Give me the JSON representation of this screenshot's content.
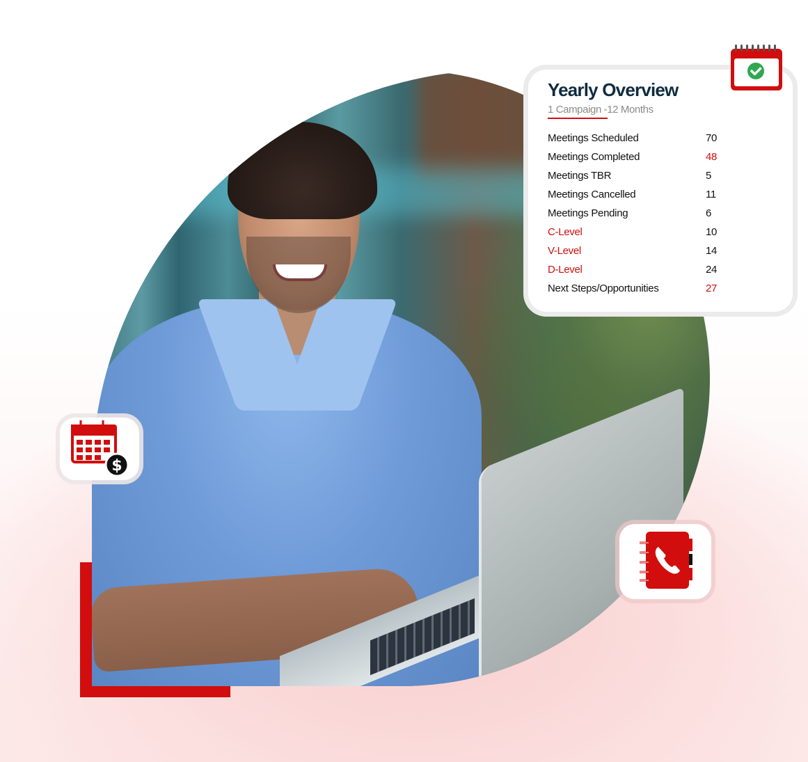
{
  "overview_card": {
    "title": "Yearly Overview",
    "subtitle": "1 Campaign -12 Months",
    "stats": [
      {
        "label": "Meetings Scheduled",
        "value": "70",
        "label_color": "default",
        "value_color": "default"
      },
      {
        "label": "Meetings Completed",
        "value": "48",
        "label_color": "default",
        "value_color": "red"
      },
      {
        "label": "Meetings TBR",
        "value": "5",
        "label_color": "default",
        "value_color": "default"
      },
      {
        "label": "Meetings Cancelled",
        "value": "11",
        "label_color": "default",
        "value_color": "default"
      },
      {
        "label": "Meetings Pending",
        "value": "6",
        "label_color": "default",
        "value_color": "default"
      },
      {
        "label": "C-Level",
        "value": "10",
        "label_color": "red",
        "value_color": "default"
      },
      {
        "label": "V-Level",
        "value": "14",
        "label_color": "red",
        "value_color": "default"
      },
      {
        "label": "D-Level",
        "value": "24",
        "label_color": "red",
        "value_color": "default"
      },
      {
        "label": "Next Steps/Opportunities",
        "value": "27",
        "label_color": "default",
        "value_color": "red"
      }
    ]
  },
  "icons": {
    "top_badge": "calendar-check-icon",
    "left_tile": "calendar-dollar-icon",
    "right_tile": "phone-book-icon"
  },
  "photo": {
    "subject": "smiling man in blue shirt holding laptop"
  },
  "colors": {
    "accent_red": "#d10d0d",
    "title_navy": "#0f2c3e",
    "check_green": "#2fa84f",
    "background_pink": "#fbd6d6"
  }
}
